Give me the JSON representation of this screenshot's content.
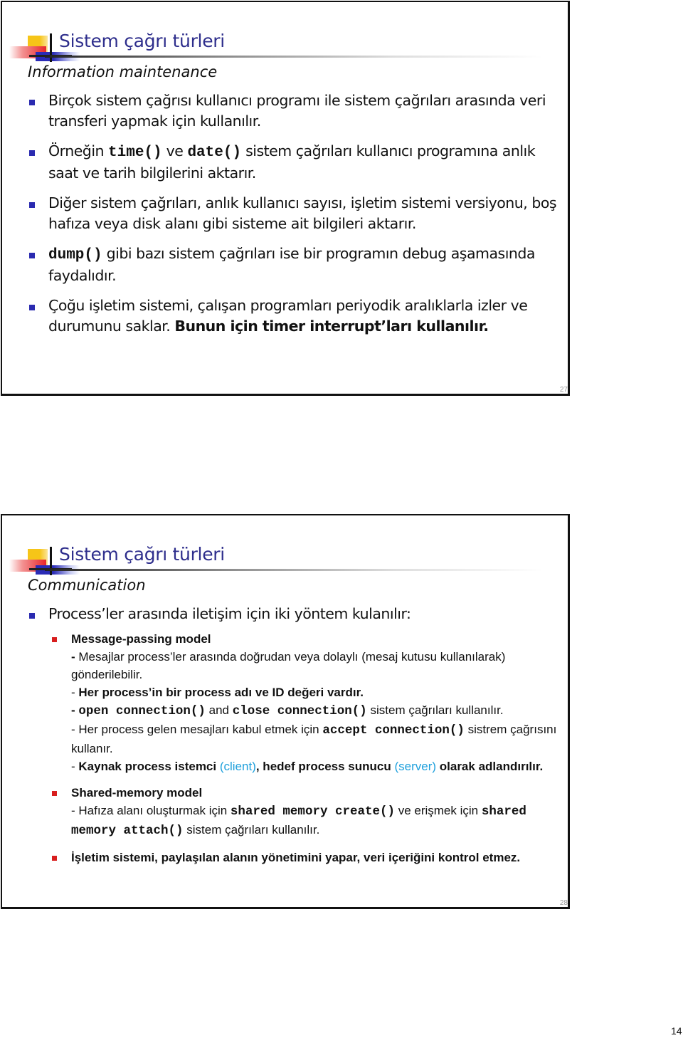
{
  "slides": [
    {
      "title": "Sistem çağrı türleri",
      "subtitle": "Information maintenance",
      "bullets": [
        {
          "text": "Birçok sistem çağrısı kullanıcı programı ile sistem çağrıları arasında veri transferi yapmak için kullanılır."
        },
        {
          "pre": "Örneğin ",
          "code1": "time()",
          "mid": " ve ",
          "code2": "date()",
          "post": " sistem çağrıları kullanıcı programına anlık saat ve tarih bilgilerini aktarır."
        },
        {
          "text": "Diğer sistem çağrıları, anlık kullanıcı sayısı, işletim sistemi versiyonu, boş hafıza veya disk alanı gibi sisteme ait bilgileri aktarır."
        },
        {
          "code": "dump()",
          "post": " gibi bazı sistem çağrıları ise bir programın debug aşamasında faydalıdır."
        },
        {
          "pre": "Çoğu işletim sistemi, çalışan programları periyodik aralıklarla izler ve durumunu saklar. ",
          "bold": "Bunun için timer interrupt’ları kullanılır."
        }
      ],
      "page_number": "27"
    },
    {
      "title": "Sistem çağrı türleri",
      "subtitle": "Communication",
      "intro": "Process’ler arasında iletişim için iki yöntem kulanılır:",
      "message_passing": {
        "heading": "Message-passing model",
        "line1_dash": "- ",
        "line1": "Mesajlar process’ler arasında doğrudan veya dolaylı (mesaj kutusu kullanılarak) gönderilebilir.",
        "line2_dash": "- ",
        "line2": "Her process’in bir process adı ve ID değeri vardır.",
        "line3_dash": "- ",
        "line3_code1": "open connection()",
        "line3_mid": " and ",
        "line3_code2": "close connection()",
        "line3_post": " sistem çağrıları kullanılır.",
        "line4_pre": "- Her process gelen mesajları kabul etmek için ",
        "line4_code": "accept connection()",
        "line4_post": " sistrem çağrısını kullanır.",
        "line5_dash": "- ",
        "line5_a": "Kaynak process istemci ",
        "line5_client": "(client)",
        "line5_b": ", hedef process sunucu ",
        "line5_server": "(server)",
        "line5_c": " olarak adlandırılır."
      },
      "shared_memory": {
        "heading": "Shared-memory model",
        "line1_pre": "- Hafıza alanı oluşturmak için ",
        "line1_code1": "shared memory create()",
        "line1_mid": " ve erişmek için ",
        "line1_code2": "shared memory attach()",
        "line1_post": " sistem çağrıları kullanılır."
      },
      "final_bullet": "İşletim sistemi, paylaşılan alanın yönetimini yapar, veri içeriğini kontrol etmez.",
      "page_number": "28"
    }
  ],
  "document_page_number": "14"
}
